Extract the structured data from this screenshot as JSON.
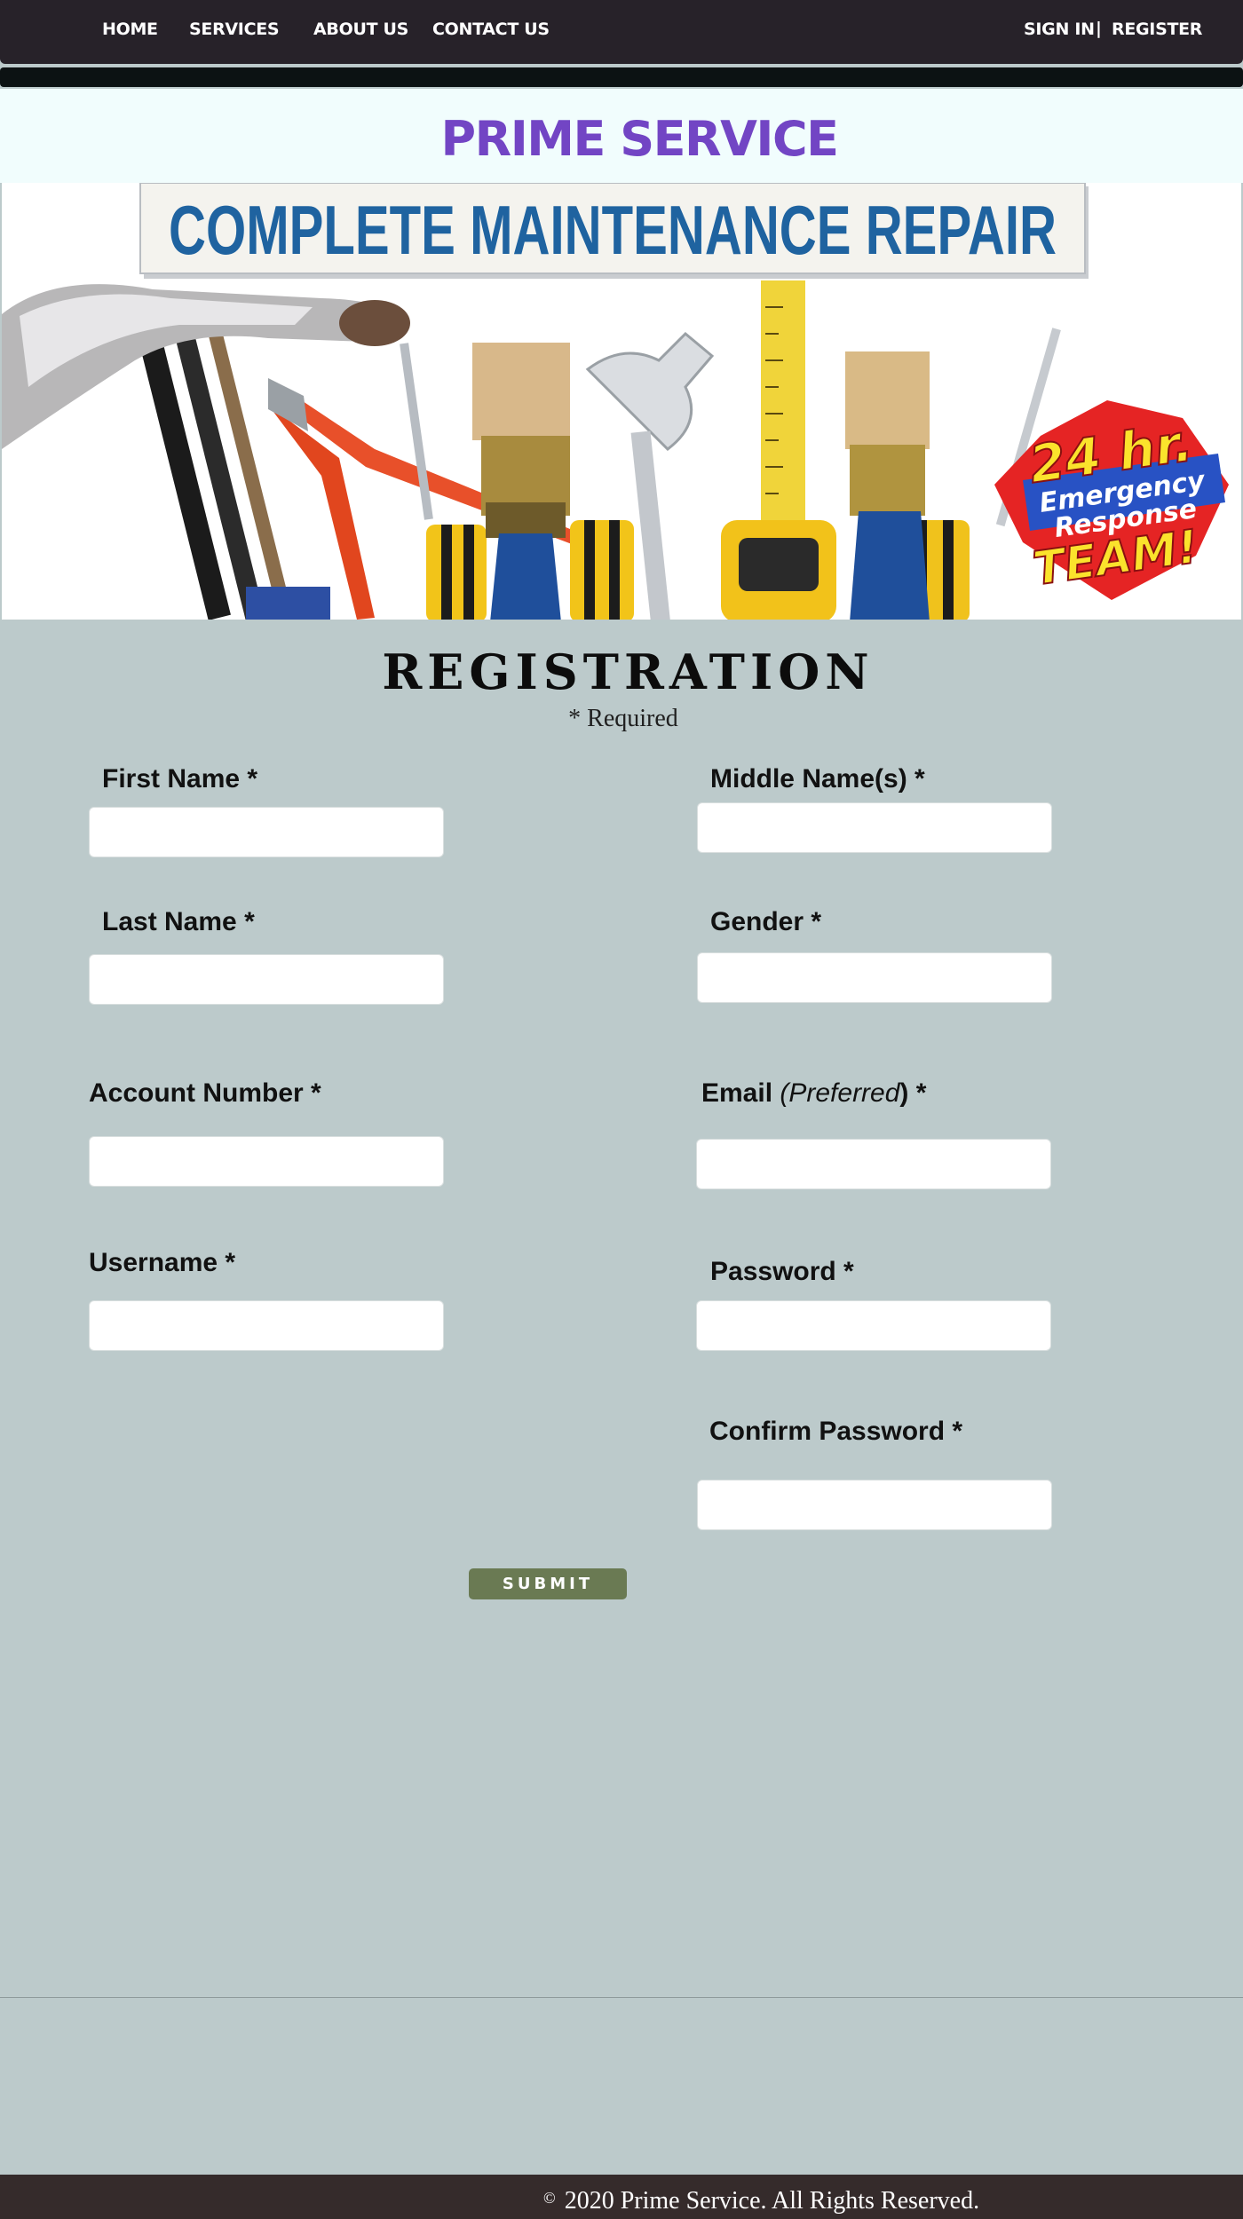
{
  "nav": {
    "items": [
      {
        "label": "HOME"
      },
      {
        "label": "SERVICES"
      },
      {
        "label": "ABOUT US"
      },
      {
        "label": "CONTACT US"
      }
    ],
    "sign_in": "SIGN IN",
    "separator": "|",
    "register": "REGISTER"
  },
  "brand": {
    "title": "PRIME SERVICE",
    "color": "#7245c4"
  },
  "banner": {
    "headline": "COMPLETE MAINTENANCE REPAIR",
    "badge": {
      "line1": "24 hr.",
      "line2": "Emergency",
      "line3": "Response",
      "line4": "TEAM!"
    }
  },
  "form": {
    "title": "REGISTRATION",
    "required_note": "* Required",
    "fields": {
      "first_name": {
        "label": "First Name *",
        "value": ""
      },
      "middle_name": {
        "label": "Middle Name(s) *",
        "value": ""
      },
      "last_name": {
        "label": "Last Name *",
        "value": ""
      },
      "gender": {
        "label": "Gender *",
        "value": ""
      },
      "account_number": {
        "label": "Account Number *",
        "value": ""
      },
      "email": {
        "label_prefix": "Email ",
        "label_italic": "(Preferred",
        "label_suffix": ") *",
        "value": ""
      },
      "username": {
        "label": "Username *",
        "value": ""
      },
      "password": {
        "label": "Password *",
        "value": ""
      },
      "confirm_password": {
        "label": "Confirm Password *",
        "value": ""
      }
    },
    "submit_label": "SUBMIT",
    "submit_color": "#6a7a53"
  },
  "footer": {
    "copyright_symbol": "©",
    "text": "2020 Prime Service. All Rights Reserved."
  },
  "colors": {
    "nav_bg": "#272229",
    "page_bg": "#bccacb",
    "footer_bg": "#352b2b"
  }
}
